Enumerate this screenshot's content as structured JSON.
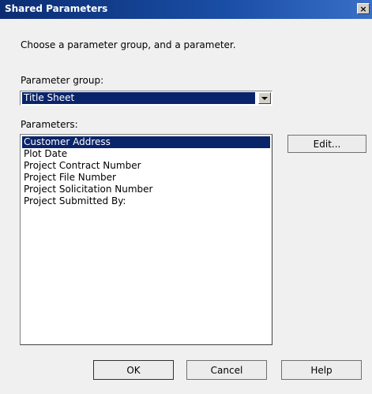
{
  "window": {
    "title": "Shared Parameters",
    "close_glyph": "×"
  },
  "prompt": "Choose a parameter group, and a parameter.",
  "parameter_group": {
    "label": "Parameter group:",
    "selected": "Title Sheet"
  },
  "parameters": {
    "label": "Parameters:",
    "items": [
      "Customer Address",
      "Plot Date",
      "Project Contract Number",
      "Project File Number",
      "Project Solicitation Number",
      "Project Submitted By:"
    ],
    "selected_index": 0
  },
  "buttons": {
    "edit": "Edit...",
    "ok": "OK",
    "cancel": "Cancel",
    "help": "Help"
  },
  "colors": {
    "selection": "#0a246a",
    "titlebar": "#0b2c72"
  }
}
